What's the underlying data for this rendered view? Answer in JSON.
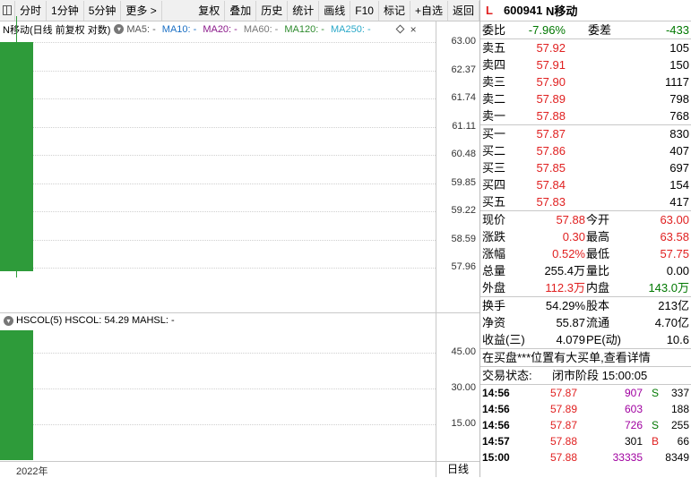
{
  "toolbar": {
    "items": [
      "分时",
      "1分钟",
      "5分钟",
      "更多 >",
      "复权",
      "叠加",
      "历史",
      "统计",
      "画线",
      "F10",
      "标记",
      "+自选",
      "返回"
    ]
  },
  "chart": {
    "info_title": "N移动(日线 前复权 对数)",
    "ma_labels": [
      {
        "text": "MA5: -",
        "color": "#555555"
      },
      {
        "text": "MA10: -",
        "color": "#1a6fc4"
      },
      {
        "text": "MA20: -",
        "color": "#8b1a8b"
      },
      {
        "text": "MA60: -",
        "color": "#777777"
      },
      {
        "text": "MA120: -",
        "color": "#2e8b2e"
      },
      {
        "text": "MA250: -",
        "color": "#2aa8c8"
      }
    ],
    "price_axis": [
      "63.00",
      "62.37",
      "61.74",
      "61.11",
      "60.48",
      "59.85",
      "59.22",
      "58.59",
      "57.96"
    ],
    "candle": {
      "open": 63.0,
      "close": 57.88,
      "high": 63.58,
      "low": 57.75,
      "color": "#2e9b3a"
    },
    "volume_info": "HSCOL(5) HSCOL: 54.29 MAHSL: -",
    "volume_axis": [
      "45.00",
      "30.00",
      "15.00"
    ],
    "volume_value": 54.29,
    "date_label": "2022年",
    "period_label": "日线"
  },
  "quote": {
    "L": "L",
    "code": "600941",
    "name": "N移动",
    "weibi_label": "委比",
    "weibi": "-7.96%",
    "weicha_label": "委差",
    "weicha": "-433",
    "asks": [
      {
        "label": "卖五",
        "price": "57.92",
        "vol": "105"
      },
      {
        "label": "卖四",
        "price": "57.91",
        "vol": "150"
      },
      {
        "label": "卖三",
        "price": "57.90",
        "vol": "1117"
      },
      {
        "label": "卖二",
        "price": "57.89",
        "vol": "798"
      },
      {
        "label": "卖一",
        "price": "57.88",
        "vol": "768"
      }
    ],
    "bids": [
      {
        "label": "买一",
        "price": "57.87",
        "vol": "830"
      },
      {
        "label": "买二",
        "price": "57.86",
        "vol": "407"
      },
      {
        "label": "买三",
        "price": "57.85",
        "vol": "697"
      },
      {
        "label": "买四",
        "price": "57.84",
        "vol": "154"
      },
      {
        "label": "买五",
        "price": "57.83",
        "vol": "417"
      }
    ],
    "stats": [
      {
        "l1": "现价",
        "v1": "57.88",
        "c1": "red",
        "l2": "今开",
        "v2": "63.00",
        "c2": "red"
      },
      {
        "l1": "涨跌",
        "v1": "0.30",
        "c1": "red",
        "l2": "最高",
        "v2": "63.58",
        "c2": "red"
      },
      {
        "l1": "涨幅",
        "v1": "0.52%",
        "c1": "red",
        "l2": "最低",
        "v2": "57.75",
        "c2": "red"
      },
      {
        "l1": "总量",
        "v1": "255.4万",
        "c1": "",
        "l2": "量比",
        "v2": "0.00",
        "c2": ""
      },
      {
        "l1": "外盘",
        "v1": "112.3万",
        "c1": "red",
        "l2": "内盘",
        "v2": "143.0万",
        "c2": "green"
      }
    ],
    "stats2": [
      {
        "l1": "换手",
        "v1": "54.29%",
        "l2": "股本",
        "v2": "213亿"
      },
      {
        "l1": "净资",
        "v1": "55.87",
        "l2": "流通",
        "v2": "4.70亿"
      },
      {
        "l1": "收益(三)",
        "v1": "4.079",
        "l2": "PE(动)",
        "v2": "10.6"
      }
    ],
    "notice": "在买盘***位置有大买单,查看详情",
    "status_label": "交易状态:",
    "status_value": "闭市阶段 15:00:05",
    "trades": [
      {
        "time": "14:56",
        "price": "57.87",
        "vol": "907",
        "volc": "purple",
        "bs": "S",
        "bsc": "green",
        "n": "337"
      },
      {
        "time": "14:56",
        "price": "57.89",
        "vol": "603",
        "volc": "purple",
        "bs": "",
        "bsc": "",
        "n": "188"
      },
      {
        "time": "14:56",
        "price": "57.87",
        "vol": "726",
        "volc": "purple",
        "bs": "S",
        "bsc": "green",
        "n": "255"
      },
      {
        "time": "14:57",
        "price": "57.88",
        "vol": "301",
        "volc": "",
        "bs": "B",
        "bsc": "red",
        "n": "66"
      },
      {
        "time": "15:00",
        "price": "57.88",
        "vol": "33335",
        "volc": "purple",
        "bs": "",
        "bsc": "",
        "n": "8349"
      }
    ]
  }
}
